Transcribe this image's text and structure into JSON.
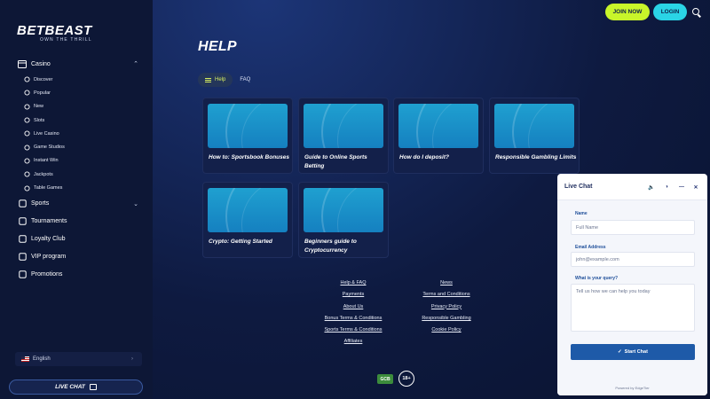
{
  "brand": {
    "name": "BETBEAST",
    "tagline": "OWN THE THRILL"
  },
  "sidebar": {
    "casino_label": "Casino",
    "casino_items": [
      {
        "label": "Discover",
        "icon": "rocket-icon"
      },
      {
        "label": "Popular",
        "icon": "flame-icon"
      },
      {
        "label": "New",
        "icon": "star-icon"
      },
      {
        "label": "Slots",
        "icon": "slots-icon"
      },
      {
        "label": "Live Casino",
        "icon": "live-icon"
      },
      {
        "label": "Game Studios",
        "icon": "studio-icon"
      },
      {
        "label": "Instant Win",
        "icon": "bolt-icon"
      },
      {
        "label": "Jackpots",
        "icon": "jackpot-icon"
      },
      {
        "label": "Table Games",
        "icon": "table-icon"
      }
    ],
    "main_items": [
      {
        "label": "Sports",
        "icon": "ball-icon"
      },
      {
        "label": "Tournaments",
        "icon": "trophy-icon"
      },
      {
        "label": "Loyalty Club",
        "icon": "crown-icon"
      },
      {
        "label": "VIP program",
        "icon": "diamond-icon"
      },
      {
        "label": "Promotions",
        "icon": "gift-icon"
      }
    ],
    "language": "English",
    "live_chat": "LIVE CHAT"
  },
  "header": {
    "join_label": "JOIN NOW",
    "login_label": "LOGIN"
  },
  "page": {
    "title": "HELP",
    "tabs": [
      "Help",
      "FAQ"
    ],
    "cards": [
      "How to: Sportsbook Bonuses",
      "Guide to Online Sports Betting",
      "How do I deposit?",
      "Responsible Gambling Limits",
      "Crypto: Getting Started",
      "Beginners guide to Cryptocurrency"
    ]
  },
  "footer": {
    "left_links": [
      "Help & FAQ",
      "Payments",
      "About Us",
      "Bonus Terms & Conditions",
      "Sports Terms & Conditions",
      "Affiliates"
    ],
    "right_links": [
      "News",
      "Terms and Conditions",
      "Privacy Policy",
      "Responsible Gambling",
      "Cookie Policy"
    ],
    "badge_gcb": "GCB",
    "badge_age": "18+"
  },
  "chat": {
    "title": "Live Chat",
    "name_label": "Name",
    "name_placeholder": "Full Name",
    "email_label": "Email Address",
    "email_placeholder": "john@example.com",
    "query_label": "What is your query?",
    "query_placeholder": "Tell us how we can help you today",
    "start_label": "Start Chat",
    "powered": "Powered by EdgeTier"
  },
  "colors": {
    "accent_green": "#c8f52a",
    "accent_cyan": "#2ad4e6",
    "chat_blue": "#1e5aa8"
  }
}
